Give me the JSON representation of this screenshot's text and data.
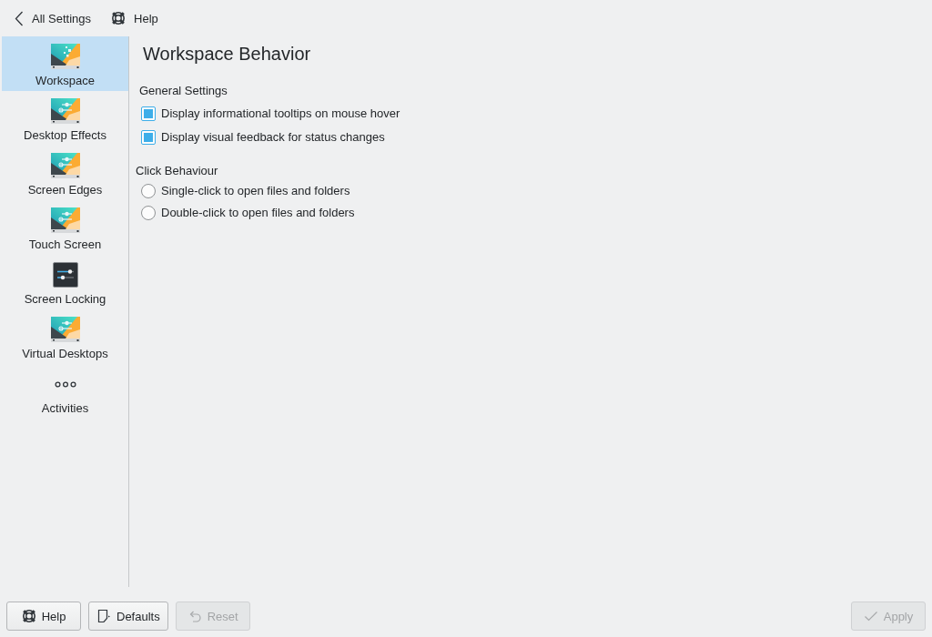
{
  "top_bar": {
    "back_button": {
      "label": "All Settings"
    },
    "help_button": {
      "label": "Help"
    }
  },
  "sidebar": {
    "items": [
      {
        "label": "Workspace",
        "kind": "sparkle",
        "selected": true
      },
      {
        "label": "Desktop Effects",
        "kind": "sliders",
        "selected": false
      },
      {
        "label": "Screen Edges",
        "kind": "sliders",
        "selected": false
      },
      {
        "label": "Touch Screen",
        "kind": "sliders",
        "selected": false
      },
      {
        "label": "Screen Locking",
        "kind": "dark",
        "selected": false
      },
      {
        "label": "Virtual Desktops",
        "kind": "sliders",
        "selected": false
      },
      {
        "label": "Activities",
        "kind": "dots",
        "selected": false
      }
    ]
  },
  "page": {
    "title": "Workspace Behavior",
    "sections": [
      {
        "heading": "General Settings",
        "kind": "checkbox",
        "options": [
          {
            "label": "Display informational tooltips on mouse hover",
            "checked": true
          },
          {
            "label": "Display visual feedback for status changes",
            "checked": true
          }
        ]
      },
      {
        "heading": "Click Behaviour",
        "kind": "radio",
        "options": [
          {
            "label": "Single-click to open files and folders",
            "selected": false
          },
          {
            "label": "Double-click to open files and folders",
            "selected": false
          }
        ]
      }
    ]
  },
  "footer": {
    "help_button": {
      "label": "Help",
      "disabled": false
    },
    "defaults_button": {
      "label": "Defaults",
      "disabled": false
    },
    "reset_button": {
      "label": "Reset",
      "disabled": true
    },
    "apply_button": {
      "label": "Apply",
      "disabled": true
    }
  }
}
